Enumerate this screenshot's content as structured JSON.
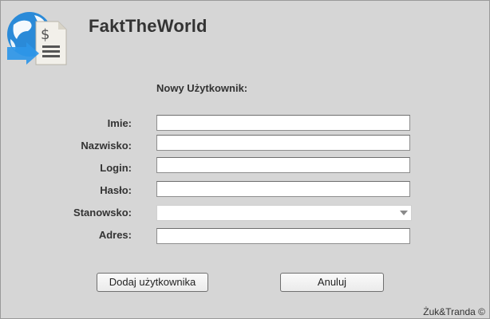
{
  "app": {
    "title": "FaktTheWorld",
    "logo_icon": "globe-invoice-icon"
  },
  "form": {
    "heading": "Nowy Użytkownik:",
    "fields": [
      {
        "label": "Imie:",
        "value": "",
        "type": "text"
      },
      {
        "label": "Nazwisko:",
        "value": "",
        "type": "text"
      },
      {
        "label": "Login:",
        "value": "",
        "type": "text"
      },
      {
        "label": "Hasło:",
        "value": "",
        "type": "password"
      },
      {
        "label": "Stanowsko:",
        "value": "",
        "type": "select"
      },
      {
        "label": "Adres:",
        "value": "",
        "type": "text"
      }
    ]
  },
  "buttons": {
    "add_label": "Dodaj użytkownika",
    "cancel_label": "Anuluj"
  },
  "footer": {
    "copyright": "Żuk&Tranda ©"
  },
  "colors": {
    "background": "#d6d6d6",
    "text": "#333333",
    "logo_blue": "#1e7fd6"
  }
}
